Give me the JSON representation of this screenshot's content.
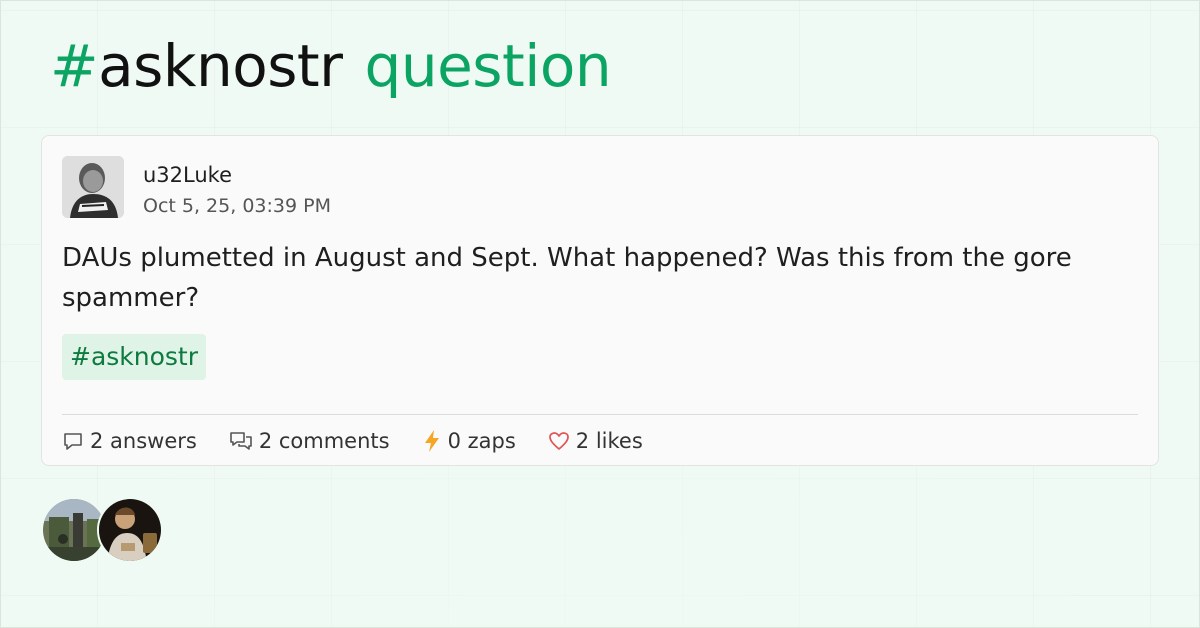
{
  "header": {
    "hash": "#",
    "tag": "asknostr",
    "kind": "question"
  },
  "post": {
    "author": "u32Luke",
    "timestamp": "Oct 5, 25, 03:39 PM",
    "body": "DAUs plumetted in August and Sept. What happened? Was this from the gore spammer?",
    "hashtag": "#asknostr",
    "stats": {
      "answers": "2 answers",
      "comments": "2 comments",
      "zaps": "0 zaps",
      "likes": "2 likes"
    }
  },
  "icons": {
    "answers": "speech-bubble-icon",
    "comments": "speech-bubbles-icon",
    "zaps": "lightning-bolt-icon",
    "likes": "heart-icon"
  },
  "colors": {
    "accent": "#0ba463",
    "chip_bg": "#dff4e6",
    "chip_text": "#0d7a3f",
    "zap": "#f5a623",
    "like": "#e05555",
    "background": "#f0faf4"
  }
}
